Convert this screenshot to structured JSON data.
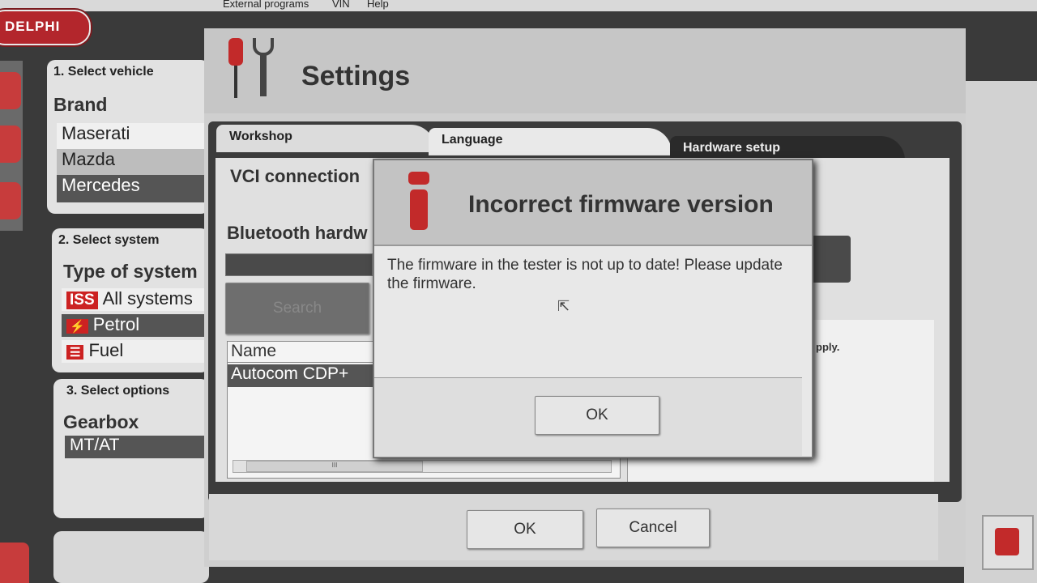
{
  "menubar": {
    "items": [
      "External programs",
      "VIN",
      "Help"
    ]
  },
  "logo": {
    "text": "DELPHI"
  },
  "panel1": {
    "heading": "1. Select vehicle",
    "label": "Brand",
    "brands": [
      "Maserati",
      "Mazda",
      "Mercedes"
    ]
  },
  "panel2": {
    "heading": "2. Select system",
    "label": "Type of system",
    "systems": [
      {
        "tag": "ISS",
        "label": "All systems"
      },
      {
        "tag": "",
        "label": "Petrol"
      },
      {
        "tag": "",
        "label": "Fuel"
      }
    ]
  },
  "panel3": {
    "heading": "3. Select options",
    "label": "Gearbox",
    "options": [
      "MT/AT"
    ]
  },
  "settings": {
    "title": "Settings",
    "tabs": [
      "Workshop",
      "Language",
      "Hardware setup"
    ],
    "vci_label": "VCI connection",
    "bluetooth_label": "Bluetooth hardw",
    "search_button": "Search",
    "table_header": "Name",
    "table_rows": [
      "Autocom CDP+"
    ],
    "scroll_thumb": "III",
    "partial_text": "pply.",
    "ok_button": "OK",
    "cancel_button": "Cancel"
  },
  "dialog": {
    "title": "Incorrect firmware version",
    "message": "The firmware in the tester is not up to date! Please update the firmware.",
    "ok_button": "OK"
  },
  "colors": {
    "accent_red": "#c22a2a",
    "selection": "#555555"
  }
}
